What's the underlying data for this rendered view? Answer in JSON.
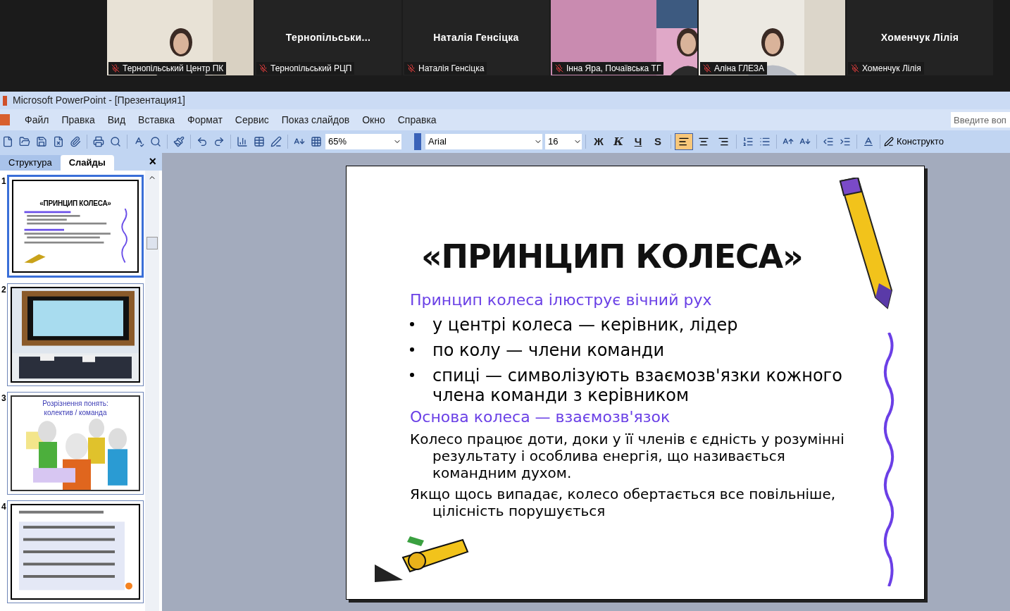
{
  "participants": [
    {
      "kind": "video",
      "label": "Тернопільський Центр ПК",
      "muted": true
    },
    {
      "kind": "name",
      "name": "Тернопільськи...",
      "label": "Тернопільський РЦП",
      "muted": true
    },
    {
      "kind": "name",
      "name": "Наталія Генсіцка",
      "label": "Наталія Генсіцка",
      "muted": true
    },
    {
      "kind": "video",
      "label": "Інна Яра, Почаївська ТГ",
      "muted": true
    },
    {
      "kind": "video",
      "label": "Аліна ГЛЕЗА",
      "muted": true
    },
    {
      "kind": "name",
      "name": "Хоменчук Лілія",
      "label": "Хоменчук Лілія",
      "muted": true
    }
  ],
  "window": {
    "title": "Microsoft PowerPoint - [Презентация1]"
  },
  "menu": [
    "Файл",
    "Правка",
    "Вид",
    "Вставка",
    "Формат",
    "Сервис",
    "Показ слайдов",
    "Окно",
    "Справка"
  ],
  "help": {
    "placeholder": "Введите воп"
  },
  "toolbar": {
    "zoom": "65%",
    "font": "Arial",
    "size": "16",
    "format_buttons": [
      "Ж",
      "К",
      "Ч",
      "S"
    ],
    "align": [
      {
        "selected": true
      },
      {
        "selected": false
      },
      {
        "selected": false
      }
    ],
    "designer": "Конструкто"
  },
  "panel": {
    "tabs": [
      {
        "label": "Структура",
        "selected": false
      },
      {
        "label": "Слайды",
        "selected": true
      }
    ],
    "close": "×"
  },
  "thumbnails": [
    {
      "number": "1",
      "kind": "text",
      "selected": true,
      "title": "«ПРИНЦИП КОЛЕСА»"
    },
    {
      "number": "2",
      "kind": "frame",
      "selected": false
    },
    {
      "number": "3",
      "kind": "people",
      "selected": false,
      "title": "Розрізнення понять: колектив / команда"
    },
    {
      "number": "4",
      "kind": "list",
      "selected": false
    }
  ],
  "slide": {
    "title": "«ПРИНЦИП КОЛЕСА»",
    "paragraphs": [
      {
        "kind": "heading",
        "text": "Принцип колеса ілюструє вічний рух"
      },
      {
        "kind": "bullet",
        "text": "у центрі колеса — керівник, лідер"
      },
      {
        "kind": "bullet",
        "text": "по колу — члени команди"
      },
      {
        "kind": "bullet",
        "text": "спиці — символізують взаємозв'язки кожного члена команди з керівником"
      },
      {
        "kind": "heading",
        "text": "Основа колеса — взаємозв'язок"
      },
      {
        "kind": "body",
        "text": "Колесо працює доти, доки у її членів є єдність у розумінні результату і особлива енергія, що називається командним духом."
      },
      {
        "kind": "body",
        "text": "Якщо щось випадає, колесо обертається все повільніше, цілісність порушується"
      }
    ]
  }
}
